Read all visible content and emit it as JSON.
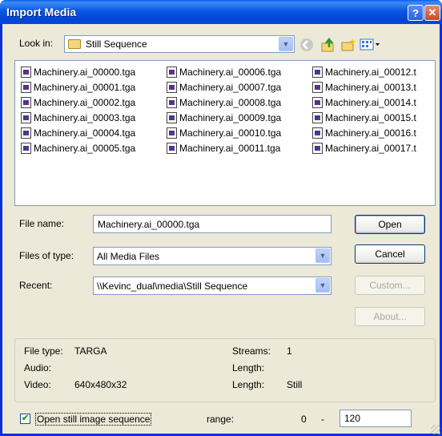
{
  "window": {
    "title": "Import Media"
  },
  "lookin": {
    "label": "Look in:",
    "value": "Still Sequence"
  },
  "files": [
    [
      "Machinery.ai_00000.tga",
      "Machinery.ai_00001.tga",
      "Machinery.ai_00002.tga",
      "Machinery.ai_00003.tga",
      "Machinery.ai_00004.tga",
      "Machinery.ai_00005.tga"
    ],
    [
      "Machinery.ai_00006.tga",
      "Machinery.ai_00007.tga",
      "Machinery.ai_00008.tga",
      "Machinery.ai_00009.tga",
      "Machinery.ai_00010.tga",
      "Machinery.ai_00011.tga"
    ],
    [
      "Machinery.ai_00012.t",
      "Machinery.ai_00013.t",
      "Machinery.ai_00014.t",
      "Machinery.ai_00015.t",
      "Machinery.ai_00016.t",
      "Machinery.ai_00017.t"
    ]
  ],
  "form": {
    "filename_label": "File name:",
    "filename_value": "Machinery.ai_00000.tga",
    "filetype_label": "Files of type:",
    "filetype_value": "All Media Files",
    "recent_label": "Recent:",
    "recent_value": "\\\\Kevinc_dual\\media\\Still Sequence"
  },
  "buttons": {
    "open": "Open",
    "cancel": "Cancel",
    "custom": "Custom...",
    "about": "About..."
  },
  "info": {
    "filetype_label": "File type:",
    "filetype_value": "TARGA",
    "audio_label": "Audio:",
    "video_label": "Video:",
    "video_value": "640x480x32",
    "streams_label": "Streams:",
    "streams_value": "1",
    "length_label": "Length:",
    "length2_label": "Length:",
    "length2_value": "Still"
  },
  "sequence": {
    "checkbox_label": "Open still image sequence",
    "checked": true,
    "range_label": "range:",
    "range_start": "0",
    "range_sep": "-",
    "range_end": "120"
  }
}
